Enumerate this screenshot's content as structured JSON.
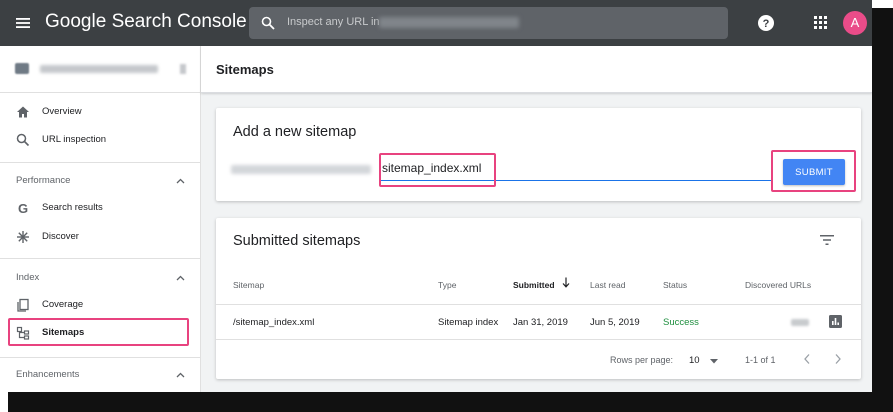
{
  "topbar": {
    "app_title_google": "Google",
    "app_title_product": "Search Console",
    "search_placeholder": "Inspect any URL in",
    "avatar_letter": "A",
    "icons": {
      "menu": "hamburger-icon",
      "search": "search-icon",
      "help": "help-icon",
      "apps": "apps-grid-icon"
    }
  },
  "sidebar": {
    "nav": [
      {
        "label": "Overview",
        "icon": "home-icon"
      },
      {
        "label": "URL inspection",
        "icon": "search-icon"
      }
    ],
    "performance": {
      "section": "Performance",
      "items": [
        {
          "label": "Search results",
          "icon": "google-g-icon"
        },
        {
          "label": "Discover",
          "icon": "discover-star-icon"
        }
      ]
    },
    "index": {
      "section": "Index",
      "items": [
        {
          "label": "Coverage",
          "icon": "coverage-icon"
        },
        {
          "label": "Sitemaps",
          "icon": "sitemap-icon"
        }
      ]
    },
    "enhancements": {
      "section": "Enhancements"
    }
  },
  "main": {
    "page_title": "Sitemaps",
    "add_card": {
      "title": "Add a new sitemap",
      "input_value": "sitemap_index.xml",
      "submit_label": "SUBMIT"
    },
    "list_card": {
      "title": "Submitted sitemaps",
      "columns": [
        "Sitemap",
        "Type",
        "Submitted",
        "Last read",
        "Status",
        "Discovered URLs"
      ],
      "rows": [
        {
          "sitemap": "/sitemap_index.xml",
          "type": "Sitemap index",
          "submitted": "Jan 31, 2019",
          "last_read": "Jun 5, 2019",
          "status": "Success"
        }
      ],
      "pager": {
        "rows_per_page_label": "Rows per page:",
        "rows_per_page": "10",
        "range": "1-1 of 1"
      }
    }
  },
  "colors": {
    "topbar": "#3c4043",
    "accent": "#4285f4",
    "highlight": "#e8437f",
    "success": "#1e8e3e"
  }
}
